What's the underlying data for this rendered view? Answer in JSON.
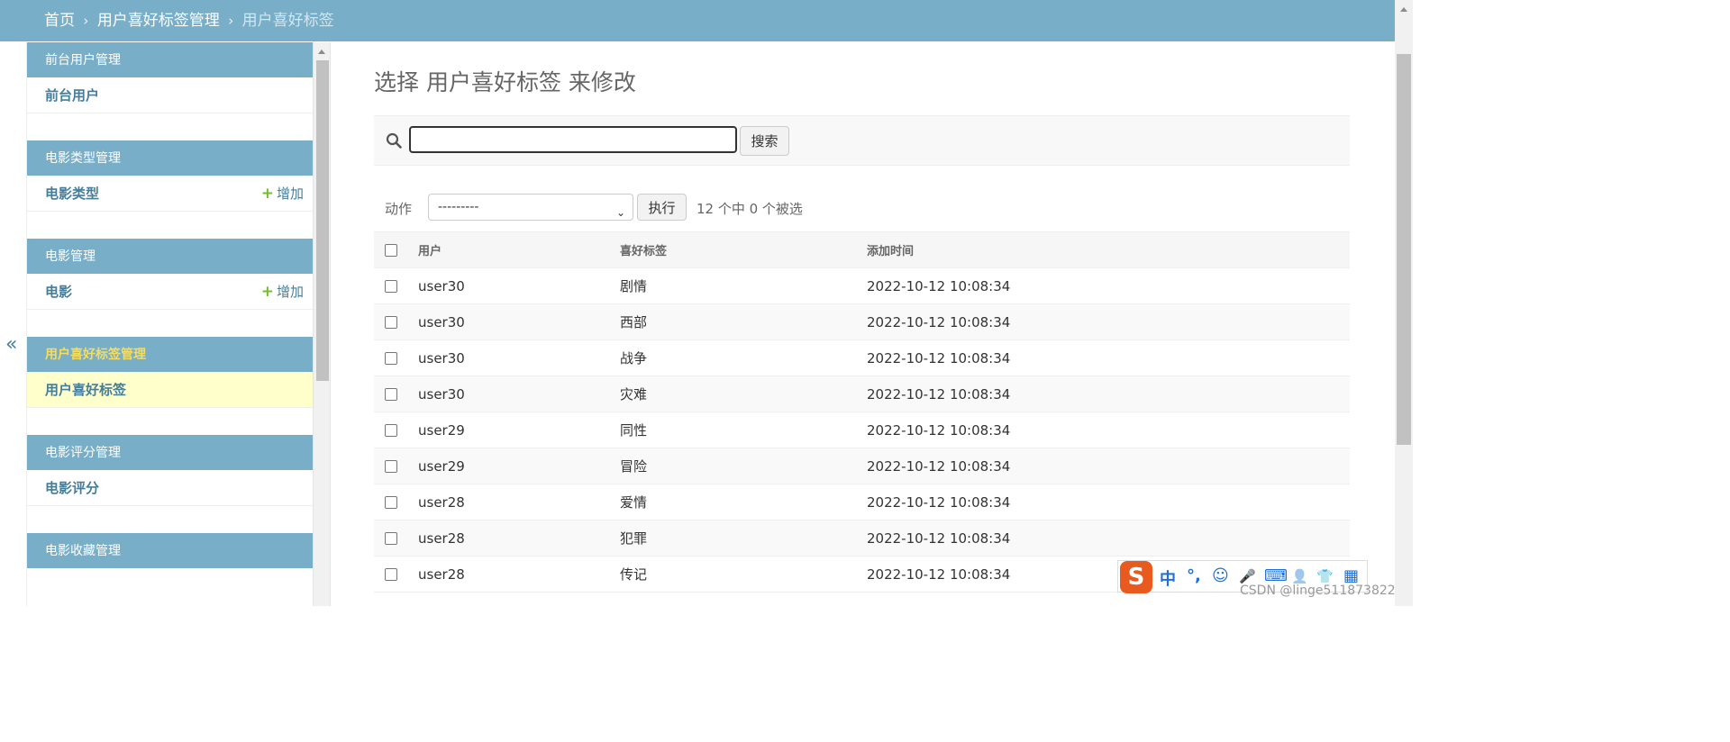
{
  "breadcrumb": {
    "home": "首页",
    "app": "用户喜好标签管理",
    "current": "用户喜好标签",
    "sep": "›"
  },
  "sidebar": {
    "collapse_glyph": "«",
    "modules": [
      {
        "caption": "前台用户管理",
        "model": "前台用户",
        "add": ""
      },
      {
        "caption": "电影类型管理",
        "model": "电影类型",
        "add": "增加"
      },
      {
        "caption": "电影管理",
        "model": "电影",
        "add": "增加"
      },
      {
        "caption": "用户喜好标签管理",
        "model": "用户喜好标签",
        "add": ""
      },
      {
        "caption": "电影评分管理",
        "model": "电影评分",
        "add": ""
      },
      {
        "caption": "电影收藏管理",
        "model": "",
        "add": ""
      }
    ],
    "add_icon": "plus-icon"
  },
  "main": {
    "title": "选择 用户喜好标签 来修改",
    "search": {
      "value": "",
      "button": "搜索"
    },
    "actions": {
      "label": "动作",
      "selected": "---------",
      "go": "执行",
      "counter": "12 个中 0 个被选"
    },
    "table": {
      "headers": [
        "用户",
        "喜好标签",
        "添加时间"
      ],
      "rows": [
        [
          "user30",
          "剧情",
          "2022-10-12 10:08:34"
        ],
        [
          "user30",
          "西部",
          "2022-10-12 10:08:34"
        ],
        [
          "user30",
          "战争",
          "2022-10-12 10:08:34"
        ],
        [
          "user30",
          "灾难",
          "2022-10-12 10:08:34"
        ],
        [
          "user29",
          "同性",
          "2022-10-12 10:08:34"
        ],
        [
          "user29",
          "冒险",
          "2022-10-12 10:08:34"
        ],
        [
          "user28",
          "爱情",
          "2022-10-12 10:08:34"
        ],
        [
          "user28",
          "犯罪",
          "2022-10-12 10:08:34"
        ],
        [
          "user28",
          "传记",
          "2022-10-12 10:08:34"
        ]
      ]
    }
  },
  "ime": {
    "logo": "S",
    "items": [
      "中",
      "°,",
      "☺",
      "🎤",
      "⌨",
      "👤",
      "👕",
      "▦"
    ]
  },
  "watermark": "CSDN @linge511873822",
  "colors": {
    "header": "#79aec8",
    "link": "#447e9b",
    "add": "#70bf2b",
    "selected_row": "#ffffcc"
  }
}
